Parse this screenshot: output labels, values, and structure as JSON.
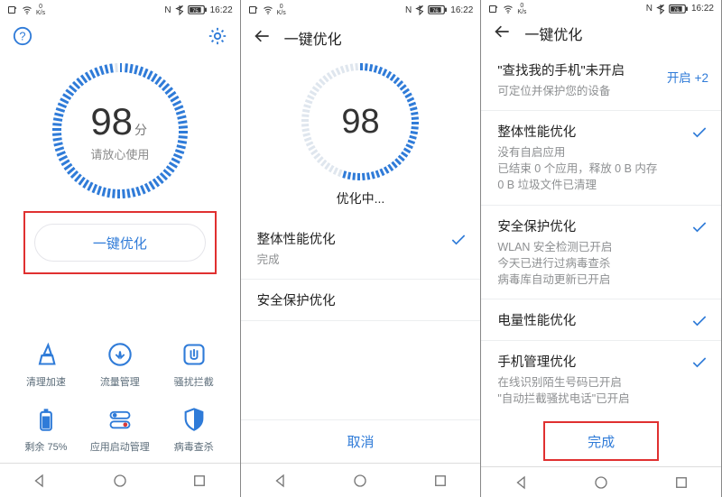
{
  "colors": {
    "accent": "#2f7bd8",
    "highlight": "#e03030",
    "text_muted": "#8d8f91"
  },
  "status": {
    "speed_val": "0",
    "speed_unit": "K/s",
    "nfc": "N",
    "battery1": "75",
    "battery2": "76",
    "time": "16:22"
  },
  "screen1": {
    "score": "98",
    "unit": "分",
    "subtitle": "请放心使用",
    "optimize_btn": "一键优化",
    "remaining_pct": "75%",
    "features": [
      {
        "label": "清理加速"
      },
      {
        "label": "流量管理"
      },
      {
        "label": "骚扰拦截"
      },
      {
        "label": "剩余 75%"
      },
      {
        "label": "应用启动管理"
      },
      {
        "label": "病毒查杀"
      }
    ]
  },
  "screen2": {
    "title": "一键优化",
    "score": "98",
    "progress_label": "优化中...",
    "items": [
      {
        "title": "整体性能优化",
        "sub": "完成",
        "check": true
      },
      {
        "title": "安全保护优化",
        "sub": "",
        "check": false
      }
    ],
    "cancel": "取消"
  },
  "screen3": {
    "title": "一键优化",
    "banner": {
      "title": "\"查找我的手机\"未开启",
      "sub": "可定位并保护您的设备",
      "action": "开启 +2"
    },
    "items": [
      {
        "title": "整体性能优化",
        "sub": "没有自启应用\n已结束 0 个应用，释放 0 B 内存\n0 B 垃圾文件已清理"
      },
      {
        "title": "安全保护优化",
        "sub": "WLAN 安全检测已开启\n今天已进行过病毒查杀\n病毒库自动更新已开启"
      },
      {
        "title": "电量性能优化",
        "sub": ""
      },
      {
        "title": "手机管理优化",
        "sub": "在线识别陌生号码已开启\n\"自动拦截骚扰电话\"已开启"
      }
    ],
    "done": "完成"
  }
}
